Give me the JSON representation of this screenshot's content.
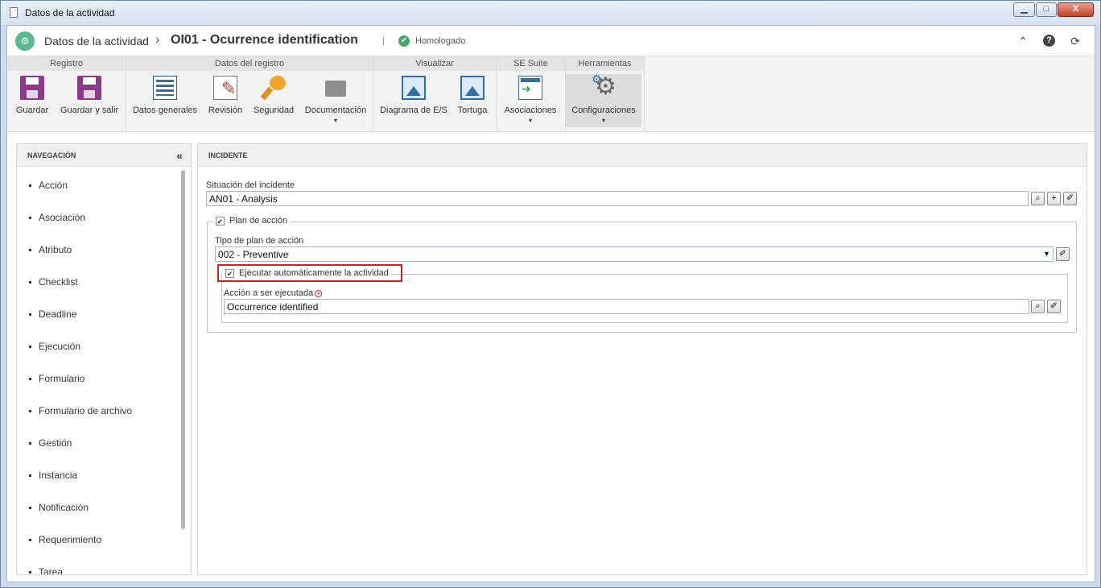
{
  "window": {
    "title": "Datos de la actividad",
    "min": "▁",
    "max": "□",
    "close": "X"
  },
  "header": {
    "app_icon": "activity-icon",
    "crumb1": "Datos de la actividad",
    "separator": "›",
    "crumb2": "OI01 - Ocurrence identification",
    "divider": "|",
    "status": "Homologado",
    "collapse": "⌃",
    "help": "?",
    "refresh": "⟳"
  },
  "ribbon": {
    "groups": [
      "Registro",
      "Datos del registro",
      "Visualizar",
      "SE Suite",
      "Herramientas"
    ],
    "buttons": {
      "guardar": "Guardar",
      "guardar_salir": "Guardar y salir",
      "datos_generales": "Datos generales",
      "revision": "Revisión",
      "seguridad": "Seguridad",
      "documentacion": "Documentación",
      "diagrama": "Diagrama de E/S",
      "tortuga": "Tortuga",
      "asociaciones": "Asociaciones",
      "configuraciones": "Configuraciones"
    },
    "arrow": "▾"
  },
  "nav": {
    "title": "NAVEGACIÓN",
    "collapse": "«",
    "items": [
      "Acción",
      "Asociación",
      "Atributo",
      "Checklist",
      "Deadline",
      "Ejecución",
      "Formulario",
      "Formulario de archivo",
      "Gestión",
      "Instancia",
      "Notificación",
      "Requerimiento",
      "Tarea"
    ]
  },
  "incident": {
    "title": "INCIDENTE",
    "situation_label": "Situación del incidente",
    "situation_value": "AN01 - Analysis",
    "plan_legend": "Plan de acción",
    "plan_type_label": "Tipo de plan de acción",
    "plan_type_value": "002 - Preventive",
    "auto_legend": "Ejecutar automáticamente la actividad",
    "action_label": "Acción a ser ejecutada",
    "action_value": "Occurrence identified",
    "check": "✔",
    "req": "×",
    "search_btn": "⌕",
    "add_btn": "+",
    "clear_btn": "✐",
    "select_arrow": "▼"
  },
  "colors": {
    "highlight": "#d32020",
    "accent": "#5bb88e"
  }
}
